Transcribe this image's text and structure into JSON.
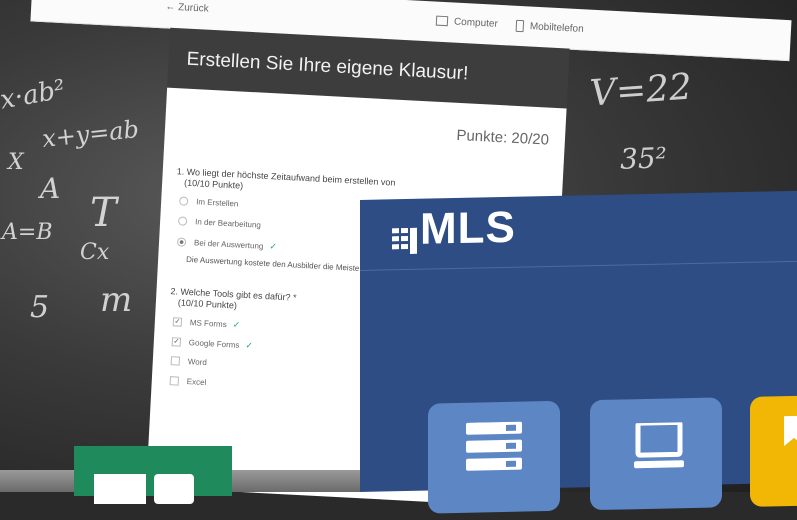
{
  "topbar": {
    "back_label": "Zurück",
    "computer_label": "Computer",
    "mobile_label": "Mobiltelefon"
  },
  "form": {
    "title": "Erstellen Sie Ihre eigene Klausur!",
    "score": "Punkte: 20/20",
    "q1": {
      "text": "1. Wo liegt der höchste Zeitaufwand beim erstellen von",
      "points": "(10/10 Punkte)",
      "options": [
        "Im Erstellen",
        "In der Bearbeitung",
        "Bei der Auswertung"
      ],
      "selected": 2,
      "feedback": "Die Auswertung kostete den Ausbilder die Meiste Zeit."
    },
    "q2": {
      "text": "2. Welche Tools gibt es dafür? *",
      "points": "(10/10 Punkte)",
      "options": [
        "MS Forms",
        "Google Forms",
        "Word",
        "Excel"
      ],
      "checked": [
        true,
        true,
        false,
        false
      ]
    }
  },
  "mls": {
    "logo": "MLS",
    "brand_color": "#2e4d84",
    "tile_color": "#5c86c4",
    "accent_tile_color": "#f2b705",
    "tiles": [
      "server-icon",
      "laptop-icon",
      "partial-tile"
    ]
  },
  "chalk": [
    "x·ab²",
    "x+y=ab",
    "V=22",
    "35²",
    "A",
    "T",
    "X",
    "5",
    "A=B",
    "Cx",
    "m"
  ],
  "green_tile_color": "#1f8a5b"
}
